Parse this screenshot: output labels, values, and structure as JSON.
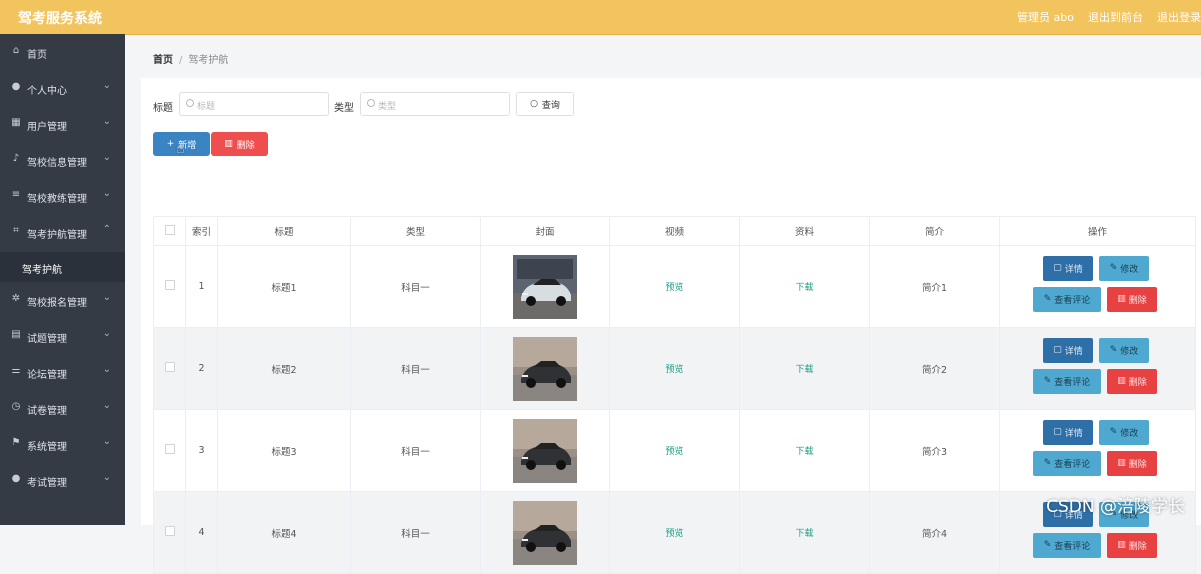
{
  "app": {
    "title": "驾考服务系统"
  },
  "topbar": {
    "user": "管理员 abo",
    "front_link": "退出到前台",
    "logout": "退出登录"
  },
  "sidebar": {
    "items": [
      {
        "label": "首页",
        "icon": "home-icon",
        "glyph": "⌂",
        "expand": ""
      },
      {
        "label": "个人中心",
        "icon": "user-icon",
        "glyph": "●",
        "expand": "⌄"
      },
      {
        "label": "用户管理",
        "icon": "grid-icon",
        "glyph": "▦",
        "expand": "⌄"
      },
      {
        "label": "驾校信息管理",
        "icon": "mic-icon",
        "glyph": "♪",
        "expand": "⌄"
      },
      {
        "label": "驾校教练管理",
        "icon": "list-icon",
        "glyph": "≡",
        "expand": "⌄"
      },
      {
        "label": "驾考护航管理",
        "icon": "crop-icon",
        "glyph": "⌗",
        "expand": "⌃"
      },
      {
        "label": "驾校报名管理",
        "icon": "compass-icon",
        "glyph": "✲",
        "expand": "⌄"
      },
      {
        "label": "试题管理",
        "icon": "doc-icon",
        "glyph": "▤",
        "expand": "⌄"
      },
      {
        "label": "论坛管理",
        "icon": "sliders-icon",
        "glyph": "⚌",
        "expand": "⌄"
      },
      {
        "label": "试卷管理",
        "icon": "clock-icon",
        "glyph": "◷",
        "expand": "⌄"
      },
      {
        "label": "系统管理",
        "icon": "flag-icon",
        "glyph": "⚑",
        "expand": "⌄"
      },
      {
        "label": "考试管理",
        "icon": "person-icon",
        "glyph": "●",
        "expand": "⌄"
      }
    ],
    "subitem": "驾考护航"
  },
  "breadcrumb": {
    "home": "首页",
    "sep": "/",
    "current": "驾考护航"
  },
  "filters": {
    "title_label": "标题",
    "title_placeholder": "标题",
    "type_label": "类型",
    "type_placeholder": "类型",
    "query_button": "查询"
  },
  "actions": {
    "add": "新增",
    "delete": "删除"
  },
  "table": {
    "headers": {
      "index": "索引",
      "title": "标题",
      "type": "类型",
      "cover": "封面",
      "video": "视频",
      "material": "资料",
      "intro": "简介",
      "ops": "操作"
    },
    "rows": [
      {
        "index": "1",
        "title": "标题1",
        "type": "科目一",
        "video": "预览",
        "material": "下载",
        "intro": "简介1"
      },
      {
        "index": "2",
        "title": "标题2",
        "type": "科目一",
        "video": "预览",
        "material": "下载",
        "intro": "简介2"
      },
      {
        "index": "3",
        "title": "标题3",
        "type": "科目一",
        "video": "预览",
        "material": "下载",
        "intro": "简介3"
      },
      {
        "index": "4",
        "title": "标题4",
        "type": "科目一",
        "video": "预览",
        "material": "下载",
        "intro": "简介4"
      }
    ],
    "row_ops": {
      "detail": "详情",
      "edit": "修改",
      "comments": "查看评论",
      "delete": "删除"
    }
  },
  "watermark": "CSDN @涪陵学长",
  "colors": {
    "topbar": "#f2c45e",
    "sidebar": "#343b45",
    "primary": "#3a84c4",
    "danger": "#ef4e4e",
    "link": "#16a085"
  }
}
